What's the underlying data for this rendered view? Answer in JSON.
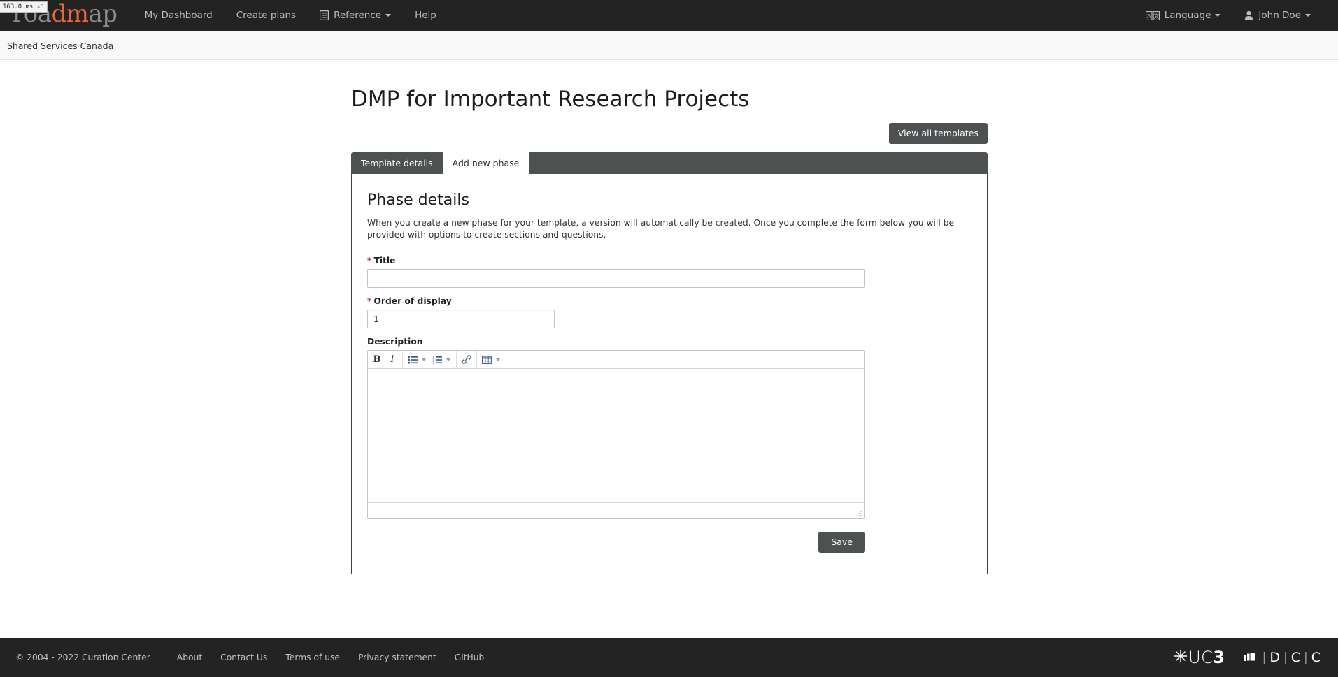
{
  "debug": {
    "badge_time": "163.0 ms",
    "badge_mult": "×5"
  },
  "navbar": {
    "brand_light": "roa",
    "brand_accent": "dm",
    "brand_tail": "ap",
    "links": [
      {
        "label": "My Dashboard",
        "icon": "",
        "caret": false
      },
      {
        "label": "Create plans",
        "icon": "",
        "caret": false
      },
      {
        "label": "Reference",
        "icon": "book-icon",
        "caret": true
      },
      {
        "label": "Help",
        "icon": "",
        "caret": false
      }
    ],
    "language_label": "Language",
    "user_label": "John Doe"
  },
  "org": {
    "name": "Shared Services Canada"
  },
  "page": {
    "title": "DMP for Important Research Projects",
    "view_all_templates": "View all templates"
  },
  "tabs": [
    {
      "label": "Template details",
      "active": false
    },
    {
      "label": "Add new phase",
      "active": true
    }
  ],
  "form": {
    "section_title": "Phase details",
    "section_description": "When you create a new phase for your template, a version will automatically be created. Once you complete the form below you will be provided with options to create sections and questions.",
    "required_marker": "*",
    "title_label": "Title",
    "title_value": "",
    "title_placeholder": "",
    "order_label": "Order of display",
    "order_value": "1",
    "description_label": "Description",
    "description_value": "",
    "save_label": "Save"
  },
  "editor_toolbar": [
    {
      "name": "bold-icon",
      "glyph": "B",
      "caret": false
    },
    {
      "name": "italic-icon",
      "glyph": "I",
      "caret": false
    },
    {
      "name": "unordered-list-icon",
      "glyph": "",
      "caret": true
    },
    {
      "name": "ordered-list-icon",
      "glyph": "",
      "caret": true
    },
    {
      "name": "link-icon",
      "glyph": "",
      "caret": false
    },
    {
      "name": "table-icon",
      "glyph": "",
      "caret": true
    }
  ],
  "footer": {
    "copyright": "© 2004 - 2022 Curation Center",
    "links": [
      "About",
      "Contact Us",
      "Terms of use",
      "Privacy statement",
      "GitHub"
    ],
    "logo_uc3_uc": "UC",
    "logo_uc3_three": "3",
    "logo_dcc_d": "D",
    "logo_dcc_c1": "C",
    "logo_dcc_c2": "C"
  },
  "colors": {
    "navbar_bg": "#232323",
    "accent_orange": "#e8663c",
    "tab_bar": "#4d5152",
    "required_red": "#a33b3b"
  }
}
